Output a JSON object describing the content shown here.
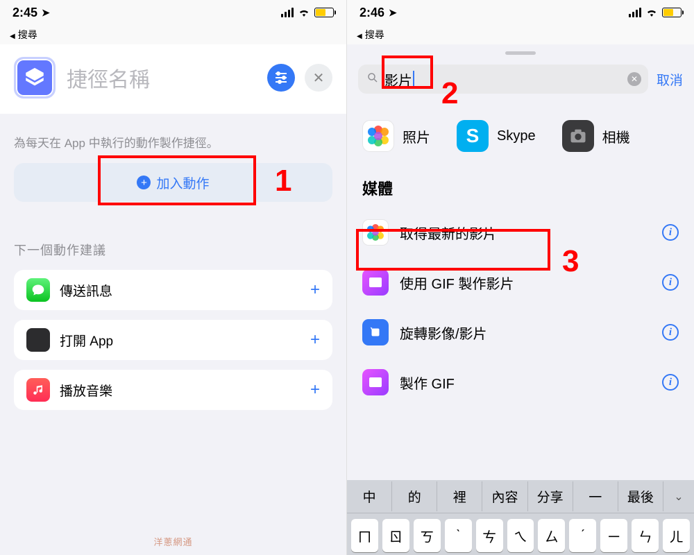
{
  "panel1": {
    "status_time": "2:45",
    "back_label": "搜尋",
    "title_placeholder": "捷徑名稱",
    "description": "為每天在 App 中執行的動作製作捷徑。",
    "add_action_label": "加入動作",
    "suggestions_title": "下一個動作建議",
    "suggestions": [
      {
        "label": "傳送訊息"
      },
      {
        "label": "打開 App"
      },
      {
        "label": "播放音樂"
      }
    ]
  },
  "panel2": {
    "status_time": "2:46",
    "back_label": "搜尋",
    "search_value": "影片",
    "cancel_label": "取消",
    "app_chips": [
      {
        "label": "照片"
      },
      {
        "label": "Skype"
      },
      {
        "label": "相機"
      }
    ],
    "section_title": "媒體",
    "media_items": [
      {
        "label": "取得最新的影片"
      },
      {
        "label": "使用 GIF 製作影片"
      },
      {
        "label": "旋轉影像/影片"
      },
      {
        "label": "製作 GIF"
      }
    ],
    "keyboard_suggestions": [
      "中",
      "的",
      "裡",
      "內容",
      "分享",
      "一",
      "最後"
    ],
    "keyboard_row1": [
      "ㄇ",
      "ㄖ",
      "ㄎ",
      "ˋ",
      "ㄘ",
      "ㄟ",
      "ㄙ",
      "ˊ",
      "ㄧ",
      "ㄣ",
      "ㄦ"
    ]
  },
  "annotations": {
    "num1": "1",
    "num2": "2",
    "num3": "3"
  },
  "watermark": "洋蔥網通"
}
